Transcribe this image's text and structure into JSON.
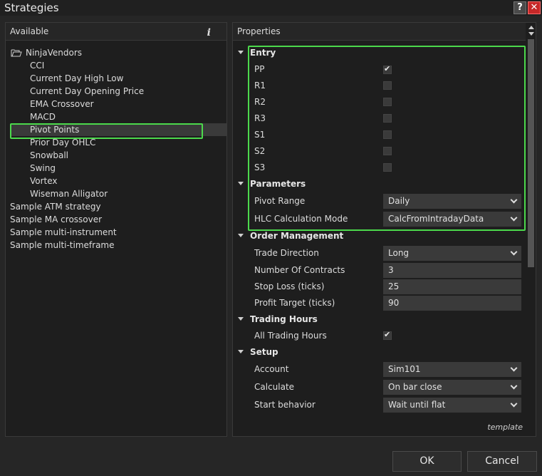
{
  "window": {
    "title": "Strategies",
    "help_label": "?",
    "close_label": "✕"
  },
  "left": {
    "header": "Available",
    "info_label": "i",
    "folder": "NinjaVendors",
    "children": [
      "CCI",
      "Current Day High Low",
      "Current Day Opening Price",
      "EMA Crossover",
      "MACD",
      "Pivot Points",
      "Prior Day OHLC",
      "Snowball",
      "Swing",
      "Vortex",
      "Wiseman Alligator"
    ],
    "root_items": [
      "Sample ATM strategy",
      "Sample MA crossover",
      "Sample multi-instrument",
      "Sample multi-timeframe"
    ],
    "selected": "Pivot Points"
  },
  "right": {
    "header": "Properties",
    "entry": {
      "title": "Entry",
      "items": [
        {
          "label": "PP",
          "checked": true,
          "check_glyph": "✔"
        },
        {
          "label": "R1",
          "checked": false
        },
        {
          "label": "R2",
          "checked": false
        },
        {
          "label": "R3",
          "checked": false
        },
        {
          "label": "S1",
          "checked": false
        },
        {
          "label": "S2",
          "checked": false
        },
        {
          "label": "S3",
          "checked": false
        }
      ]
    },
    "parameters": {
      "title": "Parameters",
      "pivot_range": {
        "label": "Pivot Range",
        "value": "Daily"
      },
      "hlc_mode": {
        "label": "HLC Calculation Mode",
        "value": "CalcFromIntradayData"
      }
    },
    "order": {
      "title": "Order Management",
      "trade_direction": {
        "label": "Trade Direction",
        "value": "Long"
      },
      "contracts": {
        "label": "Number Of Contracts",
        "value": "3"
      },
      "stop_loss": {
        "label": "Stop Loss (ticks)",
        "value": "25"
      },
      "profit_target": {
        "label": "Profit Target (ticks)",
        "value": "90"
      }
    },
    "trading_hours": {
      "title": "Trading Hours",
      "all_hours": {
        "label": "All Trading Hours",
        "check_glyph": "✔"
      }
    },
    "setup": {
      "title": "Setup",
      "account": {
        "label": "Account",
        "value": "Sim101"
      },
      "calculate": {
        "label": "Calculate",
        "value": "On bar close"
      },
      "start_behavior": {
        "label": "Start behavior",
        "value": "Wait until flat"
      }
    },
    "template_label": "template"
  },
  "buttons": {
    "ok": "OK",
    "cancel": "Cancel"
  },
  "colors": {
    "highlight": "#4cd94c",
    "close_button": "#c62828"
  }
}
